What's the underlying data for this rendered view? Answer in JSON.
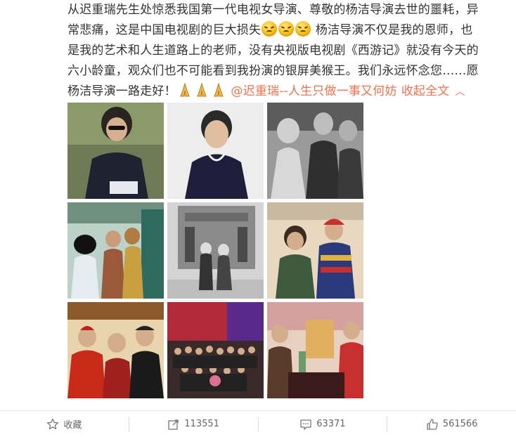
{
  "post": {
    "lines": [
      "从迟重瑞先生处惊悉我国第一代电视女导演、尊敬的杨洁导演去世的噩耗，异",
      "常悲痛，这是中国电视剧的巨大损失",
      "杨洁导演不仅是我的恩师，也",
      "是我的艺术和人生道路上的老师，没有央视版电视剧《西游记》就没有今天的",
      "六小龄童，观众们也不可能看到我扮演的银屏美猴王。我们永远怀念您……愿",
      "杨洁导演一路走好！"
    ],
    "mention": "@迟重瑞--人生只做一事又何妨",
    "collapse_label": "收起全文",
    "emoji_sad": "sad-face-emoji",
    "emoji_pray": "pray-emoji"
  },
  "photos": [
    {
      "name": "photo-young-director-sunglasses",
      "tone": "#5a6a4a"
    },
    {
      "name": "photo-director-portrait",
      "tone": "#2b2b4a"
    },
    {
      "name": "photo-film-set-bw",
      "tone": "#7a7a7a"
    },
    {
      "name": "photo-crew-monkey-king",
      "tone": "#6a8a6a"
    },
    {
      "name": "photo-couple-building-bw",
      "tone": "#8a8a8a"
    },
    {
      "name": "photo-director-with-actor",
      "tone": "#a04a3a"
    },
    {
      "name": "photo-three-in-red",
      "tone": "#c23a2a"
    },
    {
      "name": "photo-group-stage",
      "tone": "#b03040"
    },
    {
      "name": "photo-living-room",
      "tone": "#c06050"
    }
  ],
  "actions": {
    "favorite": "收藏",
    "repost": "113551",
    "comment": "63371",
    "like": "561566"
  },
  "colors": {
    "link": "#eb7350",
    "text": "#333333",
    "muted": "#666666"
  }
}
